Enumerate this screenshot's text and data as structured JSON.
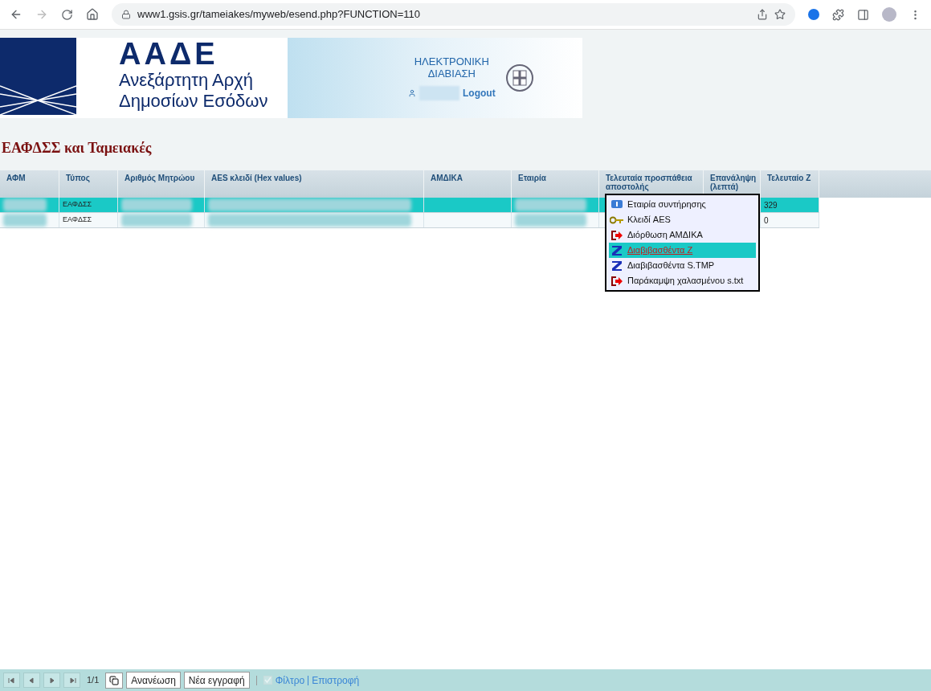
{
  "browser": {
    "url": "www1.gsis.gr/tameiakes/myweb/esend.php?FUNCTION=110"
  },
  "header": {
    "logo": "ΑΑΔΕ",
    "org_line_1": "Ανεξάρτητη Αρχή",
    "org_line_2": "Δημοσίων Εσόδων",
    "service_line_1": "ΗΛΕΚΤΡΟΝΙΚΗ",
    "service_line_2": "ΔΙΑΒΙΑΣΗ",
    "logout": "Logout"
  },
  "page_title": "ΕΑΦΔΣΣ και Ταμειακές",
  "table": {
    "columns": [
      "ΑΦΜ",
      "Τύπος",
      "Αριθμός Μητρώου",
      "AES κλειδί (Hex values)",
      "ΑΜΔΙΚΑ",
      "Εταιρία",
      "Τελευταία προσπάθεια αποστολής",
      "Επανάληψη (λεπτά)",
      "Τελευταίο Z"
    ],
    "rows": [
      {
        "selected": true,
        "type": "ΕΑΦΔΣΣ",
        "last_z": "329"
      },
      {
        "selected": false,
        "type": "ΕΑΦΔΣΣ",
        "last_z": "0"
      }
    ]
  },
  "context_menu": [
    {
      "kind": "info",
      "label": "Εταιρία συντήρησης",
      "selected": false
    },
    {
      "kind": "key",
      "label": "Κλειδί AES",
      "selected": false
    },
    {
      "kind": "exit",
      "label": "Διόρθωση ΑΜΔΙΚΑ",
      "selected": false
    },
    {
      "kind": "z",
      "label": "Διαβιβασθέντα Z",
      "selected": true
    },
    {
      "kind": "z",
      "label": "Διαβιβασθέντα S.TMP",
      "selected": false
    },
    {
      "kind": "exit",
      "label": "Παράκαμψη χαλασμένου s.txt",
      "selected": false
    }
  ],
  "footer": {
    "page": "1/1",
    "buttons": [
      "Ανανέωση",
      "Νέα εγγραφή"
    ],
    "filter": {
      "label": "Φίλτρο",
      "checked": true,
      "disabled": true
    },
    "back": "Επιστροφή"
  }
}
